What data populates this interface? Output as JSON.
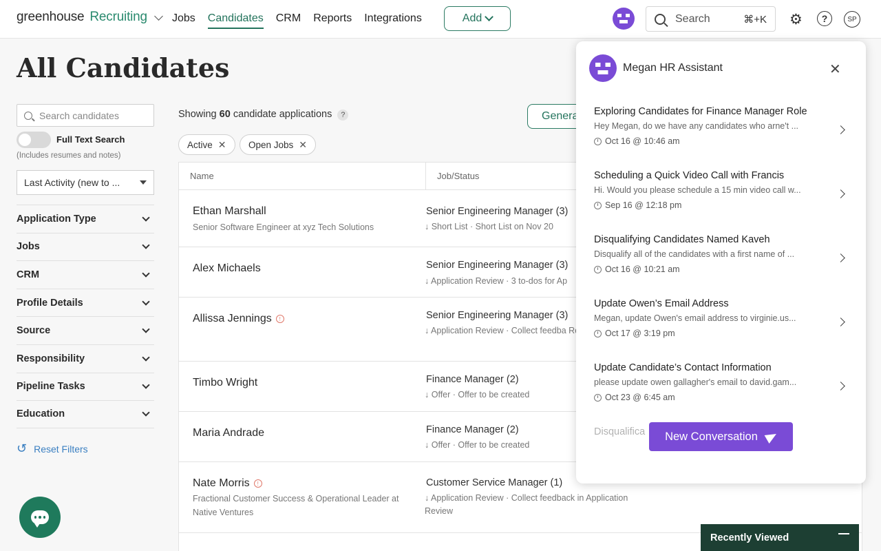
{
  "nav": {
    "brand_part1": "greenhouse",
    "brand_part2": "Recruiting",
    "links": [
      "Jobs",
      "Candidates",
      "CRM",
      "Reports",
      "Integrations"
    ],
    "active": "Candidates",
    "add_label": "Add",
    "search_label": "Search",
    "search_shortcut": "⌘+K",
    "user_initials": "SP"
  },
  "page": {
    "title": "All Candidates"
  },
  "sidebar": {
    "search_placeholder": "Search candidates",
    "full_text_label": "Full Text Search",
    "full_text_note": "(Includes resumes and notes)",
    "sort_value": "Last Activity (new to ...",
    "filters": [
      "Application Type",
      "Jobs",
      "CRM",
      "Profile Details",
      "Source",
      "Responsibility",
      "Pipeline Tasks",
      "Education"
    ],
    "reset_label": "Reset Filters"
  },
  "main": {
    "showing_prefix": "Showing",
    "showing_count": "60",
    "showing_suffix": "candidate applications",
    "generate_label": "Generate",
    "chips": [
      "Active",
      "Open Jobs"
    ],
    "columns": [
      "Name",
      "Job/Status"
    ],
    "rows": [
      {
        "name": "Ethan Marshall",
        "sub": "Senior Software Engineer at xyz Tech Solutions",
        "job": "Senior Engineering Manager (3)",
        "status": "↓ Short List  ·  Short List on Nov 20"
      },
      {
        "name": "Alex Michaels",
        "sub": "",
        "job": "Senior Engineering Manager (3)",
        "status": "↓ Application Review  ·  3 to-dos for Ap"
      },
      {
        "name": "Allissa Jennings",
        "sub": "",
        "job": "Senior Engineering Manager (3)",
        "status": "↓ Application Review  ·  Collect feedba Review"
      },
      {
        "name": "Timbo Wright",
        "sub": "",
        "job": "Finance Manager (2)",
        "status": "↓ Offer  ·  Offer to be created"
      },
      {
        "name": "Maria Andrade",
        "sub": "",
        "job": "Finance Manager (2)",
        "status": "↓ Offer  ·  Offer to be created"
      },
      {
        "name": "Nate Morris",
        "sub": "Fractional Customer Success & Operational Leader at Native Ventures",
        "job": "Customer Service Manager (1)",
        "status": "↓ Application Review  ·  Collect feedback in Application Review"
      }
    ]
  },
  "chat": {
    "title": "Megan HR Assistant",
    "conversations": [
      {
        "title": "Exploring Candidates for Finance Manager Role",
        "preview": "Hey Megan, do we have any candidates who arne't ...",
        "date": "Oct 16 @ 10:46 am"
      },
      {
        "title": "Scheduling a Quick Video Call with Francis",
        "preview": "Hi. Would you please schedule a 15 min video call w...",
        "date": "Sep 16 @ 12:18 pm"
      },
      {
        "title": "Disqualifying Candidates Named Kaveh",
        "preview": "Disqualify all of the candidates with a first name of ...",
        "date": "Oct 16 @ 10:21 am"
      },
      {
        "title": "Update Owen’s Email Address",
        "preview": "Megan, update Owen's email address to virginie.us...",
        "date": "Oct 17 @ 3:19 pm"
      },
      {
        "title": "Update Candidate’s Contact Information",
        "preview": "please update owen gallagher's email to david.gam...",
        "date": "Oct 23 @ 6:45 am"
      },
      {
        "title": "Disqualifica",
        "preview": "",
        "date": ""
      }
    ],
    "new_conversation_label": "New Conversation"
  },
  "recently_viewed": {
    "label": "Recently Viewed"
  },
  "colors": {
    "brand_green": "#23735c",
    "assistant_purple": "#7a4bd6",
    "dark_green": "#1d3f33"
  }
}
